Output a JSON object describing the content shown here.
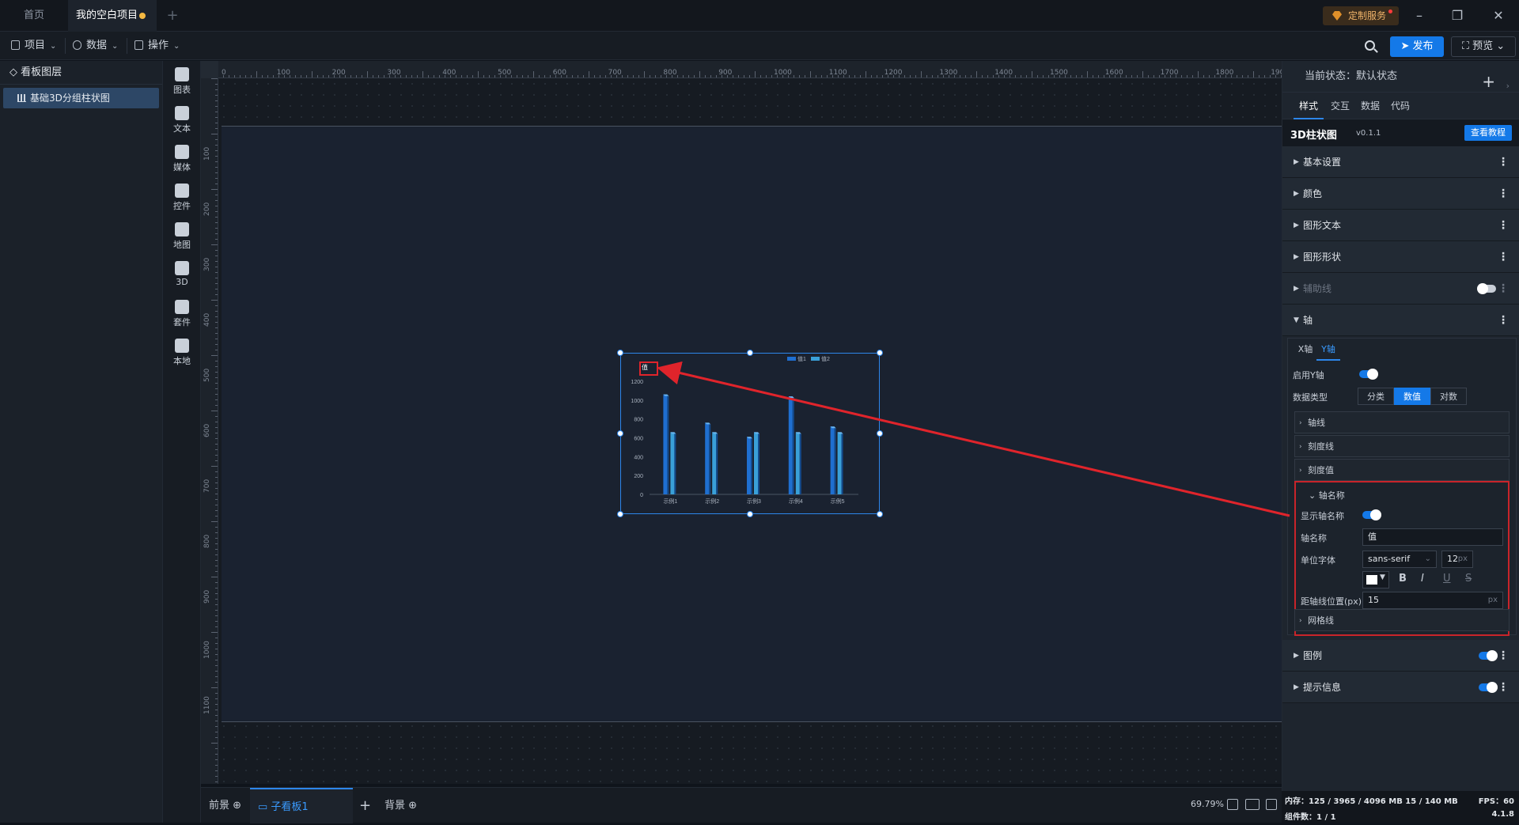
{
  "titlebar": {
    "tabs": [
      {
        "label": "首页"
      },
      {
        "label": "我的空白项目"
      }
    ],
    "service_label": "定制服务"
  },
  "toolbar": {
    "menus": [
      {
        "label": "项目"
      },
      {
        "label": "数据"
      },
      {
        "label": "操作"
      }
    ],
    "publish_label": "发布",
    "preview_label": "预览"
  },
  "layers": {
    "title": "看板图层",
    "items": [
      {
        "label": "基础3D分组柱状图"
      }
    ]
  },
  "components": [
    {
      "label": "图表"
    },
    {
      "label": "文本"
    },
    {
      "label": "媒体"
    },
    {
      "label": "控件"
    },
    {
      "label": "地图"
    },
    {
      "label": "3D"
    },
    {
      "label": "套件"
    },
    {
      "label": "本地"
    }
  ],
  "ruler": {
    "top": [
      "0",
      "100",
      "200",
      "300",
      "400",
      "500",
      "600",
      "700",
      "800",
      "900",
      "1000",
      "1100",
      "1200",
      "1300",
      "1400",
      "1500",
      "1600",
      "1700",
      "1800",
      "1900"
    ],
    "left": [
      "100",
      "200",
      "300",
      "400",
      "500",
      "600",
      "700",
      "800",
      "900",
      "1000",
      "1100"
    ]
  },
  "chart_data": {
    "type": "bar",
    "categories": [
      "示例1",
      "示例2",
      "示例3",
      "示例4",
      "示例5"
    ],
    "series": [
      {
        "name": "值1",
        "values": [
          1060,
          760,
          610,
          1040,
          720
        ]
      },
      {
        "name": "值2",
        "values": [
          660,
          660,
          660,
          660,
          660
        ]
      }
    ],
    "ylabel": "值",
    "yticks": [
      "0",
      "200",
      "400",
      "600",
      "800",
      "1000",
      "1200"
    ],
    "ylim": [
      0,
      1200
    ],
    "legend": "top-right",
    "colors": {
      "series1": "#1f6fd0",
      "series2": "#3aa0d8"
    }
  },
  "bottom": {
    "tabs": [
      {
        "label": "前景"
      },
      {
        "label": "子看板1"
      },
      {
        "label": "背景"
      }
    ],
    "zoom": "69.79%"
  },
  "panel": {
    "state_label": "当前状态：默认状态",
    "tabs": [
      {
        "label": "样式"
      },
      {
        "label": "交互"
      },
      {
        "label": "数据"
      },
      {
        "label": "代码"
      }
    ],
    "component_title": "3D柱状图",
    "version": "v0.1.1",
    "tutorial_label": "查看教程",
    "sections": [
      {
        "label": "基本设置"
      },
      {
        "label": "颜色"
      },
      {
        "label": "图形文本"
      },
      {
        "label": "图形形状"
      },
      {
        "label": "辅助线"
      },
      {
        "label": "轴"
      }
    ],
    "axis": {
      "tabs": [
        {
          "label": "X轴"
        },
        {
          "label": "Y轴"
        }
      ],
      "enable_label": "启用Y轴",
      "datatype_label": "数据类型",
      "datatype_options": [
        "分类",
        "数值",
        "对数"
      ],
      "datatype_selected": "数值",
      "subsections": [
        {
          "label": "轴线"
        },
        {
          "label": "刻度线"
        },
        {
          "label": "刻度值"
        }
      ],
      "axis_name": {
        "title": "轴名称",
        "show_label": "显示轴名称",
        "name_label": "轴名称",
        "name_value": "值",
        "font_label": "单位字体",
        "font_value": "sans-serif",
        "size_value": "12",
        "size_unit": "px",
        "color_value": "#ffffff",
        "bold": "B",
        "italic": "I",
        "underline": "U",
        "strike": "S",
        "offset_label": "距轴线位置(px)",
        "offset_value": "15",
        "offset_unit": "px"
      },
      "grid_label": "网格线"
    },
    "legend_label": "图例",
    "tooltip_label": "提示信息"
  },
  "status": {
    "memory": "内存：125 / 3965 / 4096 MB 15 / 140 MB",
    "fps": "FPS：60",
    "count": "组件数：1 / 1",
    "version": "4.1.8"
  }
}
